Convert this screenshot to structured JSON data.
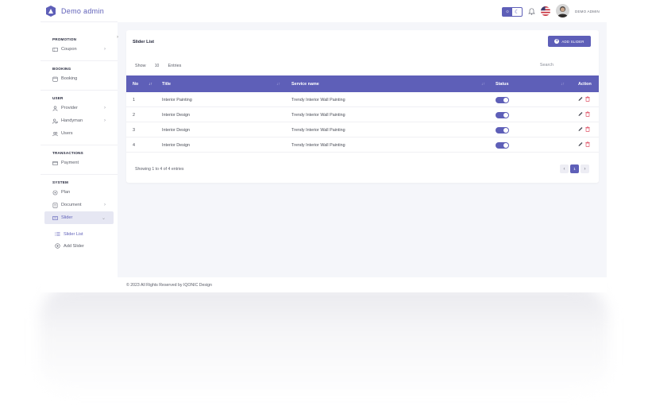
{
  "brand": {
    "name": "Demo admin"
  },
  "header": {
    "user_name": "DEMO ADMIN"
  },
  "sidebar": {
    "sections": [
      {
        "title": "PROMOTION",
        "items": [
          {
            "label": "Coupon",
            "icon": "ticket-icon",
            "has_chevron": true
          }
        ]
      },
      {
        "title": "BOOKING",
        "items": [
          {
            "label": "Booking",
            "icon": "calendar-icon",
            "has_chevron": false
          }
        ]
      },
      {
        "title": "USER",
        "items": [
          {
            "label": "Provider",
            "icon": "user-icon",
            "has_chevron": true
          },
          {
            "label": "Handyman",
            "icon": "user-gear-icon",
            "has_chevron": true
          },
          {
            "label": "Users",
            "icon": "users-icon",
            "has_chevron": false
          }
        ]
      },
      {
        "title": "TRANSACTIONS",
        "items": [
          {
            "label": "Payment",
            "icon": "card-icon",
            "has_chevron": false
          }
        ]
      },
      {
        "title": "SYSTEM",
        "items": [
          {
            "label": "Plan",
            "icon": "plan-icon",
            "has_chevron": false
          },
          {
            "label": "Document",
            "icon": "document-icon",
            "has_chevron": true
          },
          {
            "label": "Slider",
            "icon": "slider-icon",
            "has_chevron": true,
            "active": true
          }
        ]
      }
    ],
    "sub_items": [
      {
        "label": "Slider List",
        "icon": "list-icon",
        "active": true
      },
      {
        "label": "Add Slider",
        "icon": "add-circle-icon",
        "active": false
      }
    ]
  },
  "card": {
    "title": "Slider List",
    "add_button": "ADD SLIDER",
    "show_label": "Show",
    "show_value": "10",
    "entries_label": "Entries",
    "search_label": "Search"
  },
  "table": {
    "headers": {
      "no": "No",
      "title": "Title",
      "service": "Service name",
      "status": "Status",
      "action": "Action"
    },
    "rows": [
      {
        "no": "1",
        "title": "Interior Painting",
        "service": "Trendy Interior Wall Painting",
        "status": true
      },
      {
        "no": "2",
        "title": "Interior Design",
        "service": "Trendy Interior Wall Painting",
        "status": true
      },
      {
        "no": "3",
        "title": "Interior Design",
        "service": "Trendy Interior Wall Painting",
        "status": true
      },
      {
        "no": "4",
        "title": "Interior Design",
        "service": "Trendy Interior Wall Painting",
        "status": true
      }
    ],
    "info": "Showing 1 to 4 of 4 entries",
    "page": "1"
  },
  "footer": {
    "text": "© 2023 All Rights Reserved by IQONIC Design"
  },
  "colors": {
    "accent": "#5e5fb8",
    "danger": "#e0566a",
    "background": "#f5f6fa"
  }
}
